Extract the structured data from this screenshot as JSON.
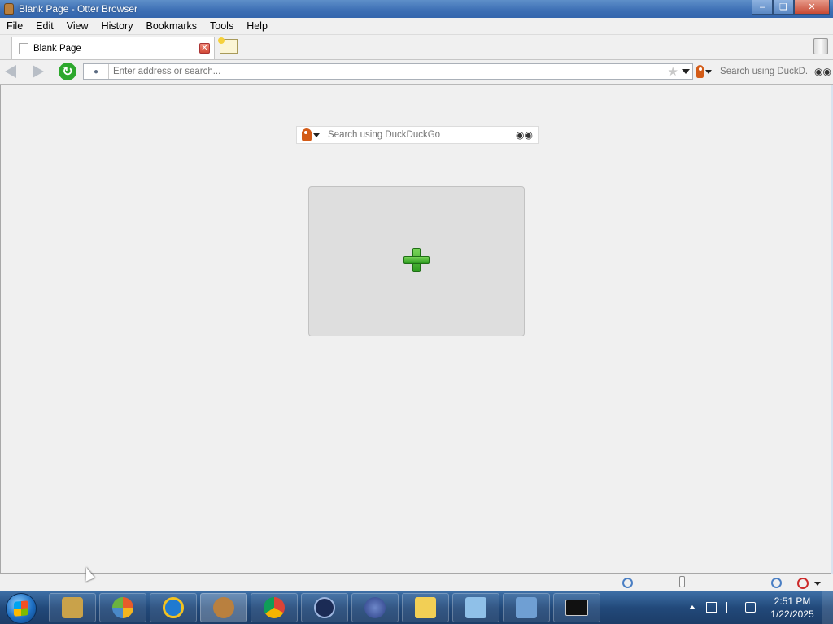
{
  "window": {
    "title": "Blank Page - Otter Browser"
  },
  "menu": [
    "File",
    "Edit",
    "View",
    "History",
    "Bookmarks",
    "Tools",
    "Help"
  ],
  "tabs": [
    {
      "label": "Blank Page",
      "active": true
    }
  ],
  "toolbar": {
    "address_placeholder": "Enter address or search...",
    "search_placeholder": "Search using DuckD..."
  },
  "content": {
    "search_placeholder": "Search using DuckDuckGo"
  },
  "taskbar": {
    "clock_time": "2:51 PM",
    "clock_date": "1/22/2025"
  },
  "colors": {
    "titlebar": "#3c6eb4",
    "content_bg": "#f0f0f0",
    "speed_dial_bg": "#dedede",
    "plus_green": "#2d9b1f",
    "taskbar": "#22497a"
  },
  "icons": [
    "otter-app-icon",
    "minimize-icon",
    "maximize-icon",
    "close-icon",
    "page-icon",
    "tab-close-icon",
    "new-tab-icon",
    "trash-icon",
    "back-icon",
    "forward-icon",
    "reload-icon",
    "site-info-icon",
    "star-icon",
    "dropdown-icon",
    "duckduckgo-icon",
    "binoculars-icon",
    "plus-icon",
    "zoom-out-icon",
    "zoom-in-icon",
    "blocked-icon",
    "windows-start-icon"
  ]
}
